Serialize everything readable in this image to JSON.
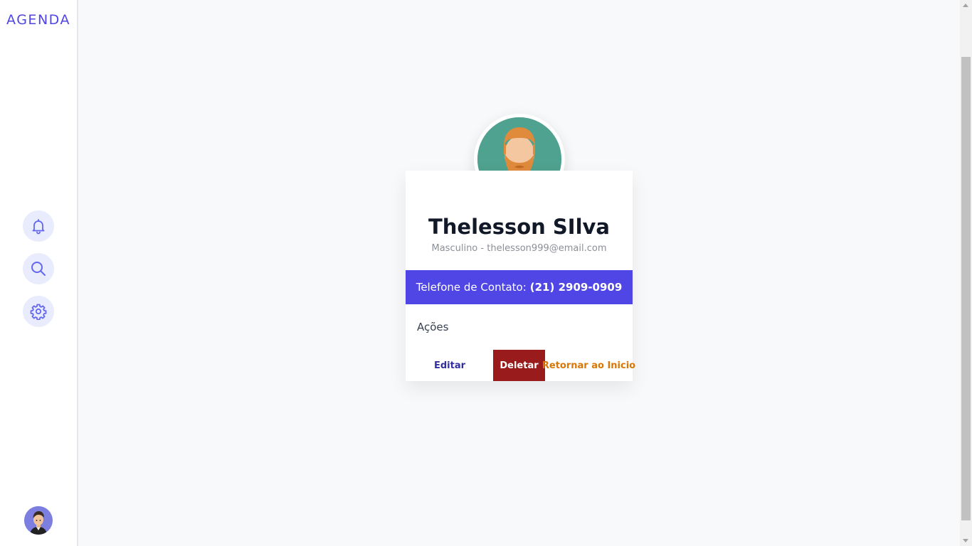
{
  "sidebar": {
    "brand": "AGENDA",
    "buttons": [
      {
        "icon": "bell-icon"
      },
      {
        "icon": "search-icon"
      },
      {
        "icon": "gear-icon"
      }
    ],
    "user_avatar_icon": "user-avatar"
  },
  "contact": {
    "name": "Thelesson SIlva",
    "gender": "Masculino",
    "separator": " - ",
    "email": "thelesson999@email.com",
    "phone_label": "Telefone de Contato:",
    "phone": "(21) 2909-0909",
    "actions_title": "Ações",
    "actions": {
      "edit": "Editar",
      "delete": "Deletar",
      "return": "Retornar ao Inicio"
    }
  },
  "colors": {
    "accent": "#4f46e5",
    "delete": "#991b1b",
    "return": "#d97706",
    "edit": "#312e9e"
  }
}
